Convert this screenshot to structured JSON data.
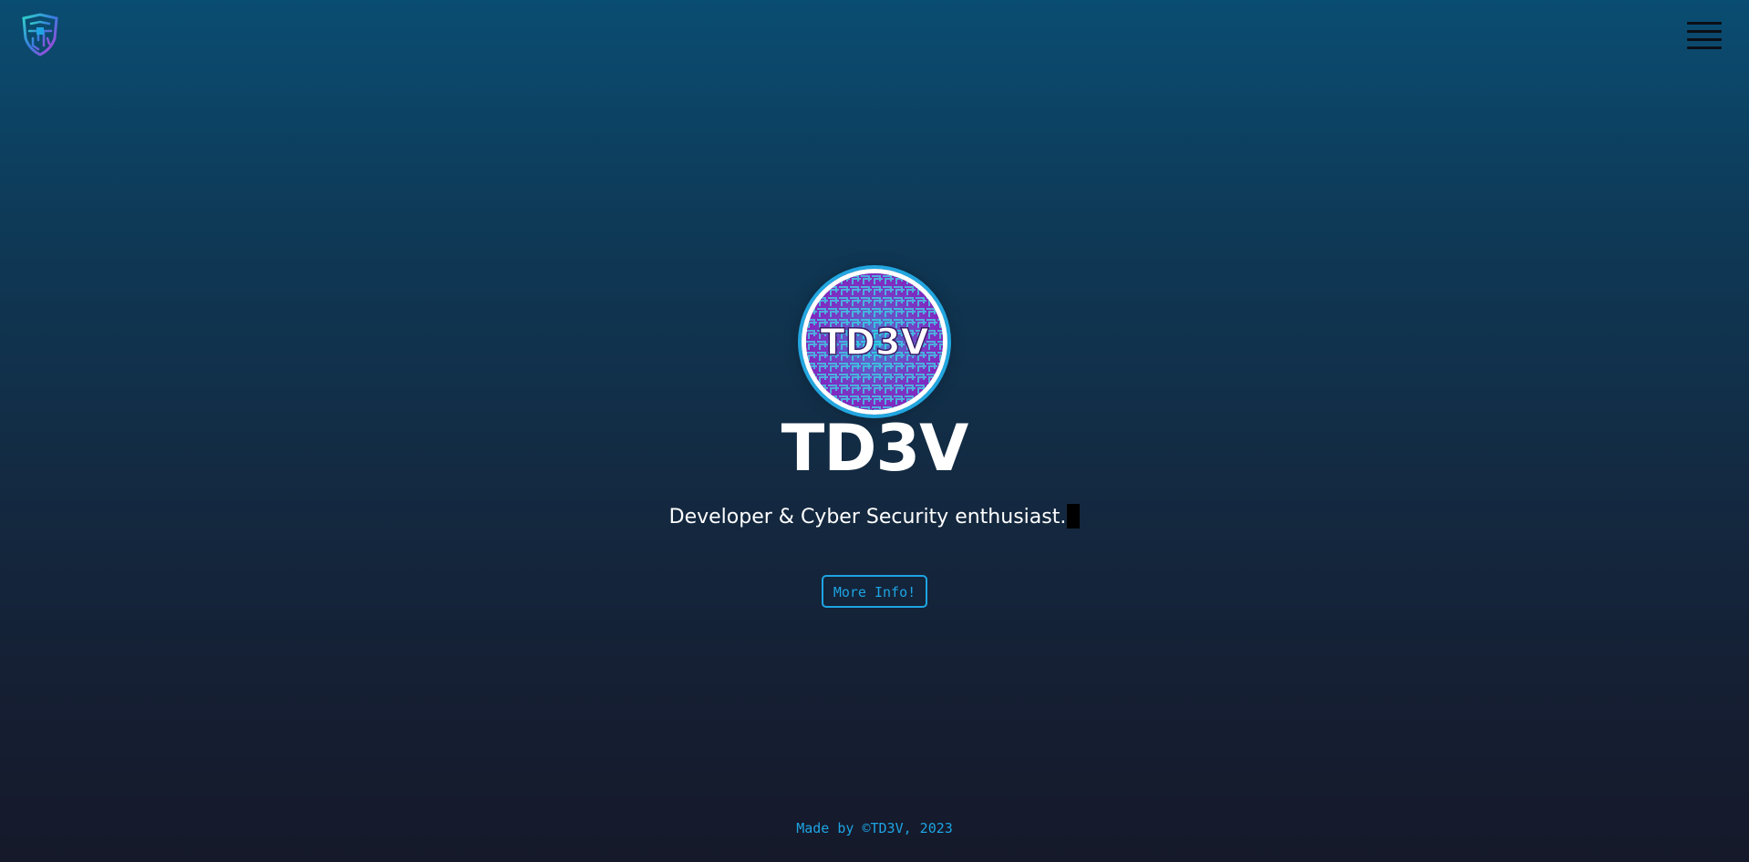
{
  "header": {
    "logo_icon": "circuit-shield-logo",
    "menu_icon": "hamburger-menu-icon"
  },
  "hero": {
    "avatar_text": "TD3V",
    "title": "TD3V",
    "tagline": "Developer & Cyber Security enthusiast.",
    "button_label": "More Info!"
  },
  "footer": {
    "text": "Made by ©TD3V, 2023"
  },
  "colors": {
    "accent": "#1ea4e3",
    "background_top": "#0a4d72",
    "background_bottom": "#15192a",
    "maze_purple": "#8a2bd6",
    "maze_cyan": "#27d3e0"
  }
}
